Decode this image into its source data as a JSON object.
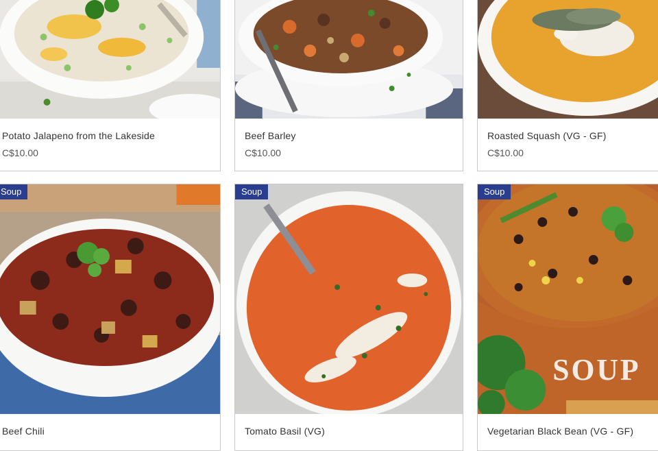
{
  "products": [
    {
      "title": "Potato Jalapeno from the Lakeside",
      "price": "C$10.00",
      "badge": ""
    },
    {
      "title": "Beef Barley",
      "price": "C$10.00",
      "badge": ""
    },
    {
      "title": "Roasted Squash (VG - GF)",
      "price": "C$10.00",
      "badge": ""
    },
    {
      "title": "Beef Chili",
      "price": "",
      "badge": "Soup"
    },
    {
      "title": "Tomato Basil (VG)",
      "price": "",
      "badge": "Soup"
    },
    {
      "title": "Vegetarian Black Bean (VG - GF)",
      "price": "",
      "badge": "Soup"
    }
  ],
  "bowl_lettering": "SOUP",
  "colors": {
    "badge": "#2a3e8f",
    "border": "#c9c9c9",
    "text": "#333333"
  }
}
